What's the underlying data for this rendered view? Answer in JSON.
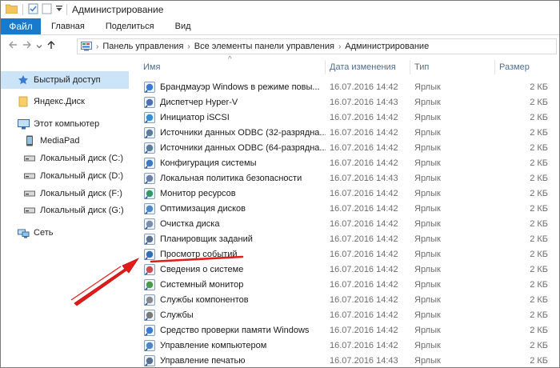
{
  "window": {
    "title": "Администрирование"
  },
  "ribbon": {
    "tabs": [
      "Файл",
      "Главная",
      "Поделиться",
      "Вид"
    ]
  },
  "address": {
    "crumbs": [
      "Панель управления",
      "Все элементы панели управления",
      "Администрирование"
    ]
  },
  "nav": {
    "items": [
      {
        "label": "Быстрый доступ",
        "icon": "star-icon",
        "selected": true
      },
      {
        "label": "Яндекс.Диск",
        "icon": "folder-icon"
      },
      {
        "label": "Этот компьютер",
        "icon": "computer-icon"
      },
      {
        "label": "MediaPad",
        "icon": "phone-icon"
      },
      {
        "label": "Локальный диск (C:)",
        "icon": "drive-icon"
      },
      {
        "label": "Локальный диск (D:)",
        "icon": "drive-icon"
      },
      {
        "label": "Локальный диск (F:)",
        "icon": "drive-icon"
      },
      {
        "label": "Локальный диск (G:)",
        "icon": "drive-icon"
      },
      {
        "label": "Сеть",
        "icon": "network-icon"
      }
    ]
  },
  "columns": {
    "name": "Имя",
    "date": "Дата изменения",
    "type": "Тип",
    "size": "Размер"
  },
  "files": [
    {
      "name": "Брандмауэр Windows в режиме повы...",
      "date": "16.07.2016 14:42",
      "type": "Ярлык",
      "size": "2 КБ"
    },
    {
      "name": "Диспетчер Hyper-V",
      "date": "16.07.2016 14:43",
      "type": "Ярлык",
      "size": "2 КБ"
    },
    {
      "name": "Инициатор iSCSI",
      "date": "16.07.2016 14:42",
      "type": "Ярлык",
      "size": "2 КБ"
    },
    {
      "name": "Источники данных ODBC (32-разрядна...",
      "date": "16.07.2016 14:42",
      "type": "Ярлык",
      "size": "2 КБ"
    },
    {
      "name": "Источники данных ODBC (64-разрядна...",
      "date": "16.07.2016 14:42",
      "type": "Ярлык",
      "size": "2 КБ"
    },
    {
      "name": "Конфигурация системы",
      "date": "16.07.2016 14:42",
      "type": "Ярлык",
      "size": "2 КБ"
    },
    {
      "name": "Локальная политика безопасности",
      "date": "16.07.2016 14:43",
      "type": "Ярлык",
      "size": "2 КБ"
    },
    {
      "name": "Монитор ресурсов",
      "date": "16.07.2016 14:42",
      "type": "Ярлык",
      "size": "2 КБ"
    },
    {
      "name": "Оптимизация дисков",
      "date": "16.07.2016 14:42",
      "type": "Ярлык",
      "size": "2 КБ"
    },
    {
      "name": "Очистка диска",
      "date": "16.07.2016 14:42",
      "type": "Ярлык",
      "size": "2 КБ"
    },
    {
      "name": "Планировщик заданий",
      "date": "16.07.2016 14:42",
      "type": "Ярлык",
      "size": "2 КБ"
    },
    {
      "name": "Просмотр событий",
      "date": "16.07.2016 14:42",
      "type": "Ярлык",
      "size": "2 КБ"
    },
    {
      "name": "Сведения о системе",
      "date": "16.07.2016 14:42",
      "type": "Ярлык",
      "size": "2 КБ"
    },
    {
      "name": "Системный монитор",
      "date": "16.07.2016 14:42",
      "type": "Ярлык",
      "size": "2 КБ"
    },
    {
      "name": "Службы компонентов",
      "date": "16.07.2016 14:42",
      "type": "Ярлык",
      "size": "2 КБ"
    },
    {
      "name": "Службы",
      "date": "16.07.2016 14:42",
      "type": "Ярлык",
      "size": "2 КБ"
    },
    {
      "name": "Средство проверки памяти Windows",
      "date": "16.07.2016 14:42",
      "type": "Ярлык",
      "size": "2 КБ"
    },
    {
      "name": "Управление компьютером",
      "date": "16.07.2016 14:42",
      "type": "Ярлык",
      "size": "2 КБ"
    },
    {
      "name": "Управление печатью",
      "date": "16.07.2016 14:43",
      "type": "Ярлык",
      "size": "2 КБ"
    }
  ],
  "colors": {
    "accent": "#1979ca",
    "selection": "#cce4f7",
    "annotation": "#e21b1b",
    "header_text": "#4d6d8f"
  }
}
